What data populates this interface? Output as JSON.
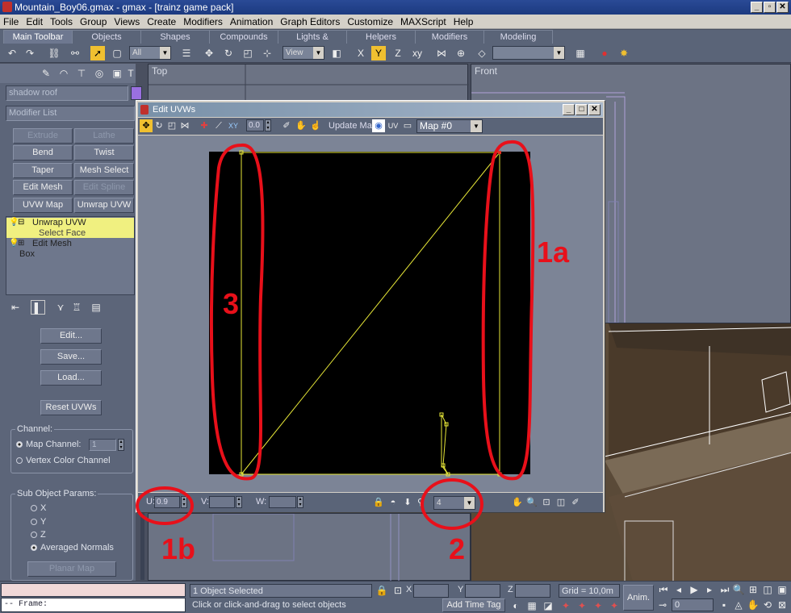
{
  "window": {
    "title": "Mountain_Boy06.gmax - gmax - [trainz game pack]",
    "minimize": "_",
    "restore": "▫",
    "close": "✕"
  },
  "menu": [
    "File",
    "Edit",
    "Tools",
    "Group",
    "Views",
    "Create",
    "Modifiers",
    "Animation",
    "Graph Editors",
    "Customize",
    "MAXScript",
    "Help"
  ],
  "tabs": [
    "Main Toolbar",
    "Objects",
    "Shapes",
    "Compounds",
    "Lights & Cameras",
    "Helpers",
    "Modifiers",
    "Modeling"
  ],
  "toolbar": {
    "selection_filter": "All",
    "coord_system": "View"
  },
  "command_panel": {
    "object_name": "shadow roof",
    "modifier_list": "Modifier List",
    "buttons": [
      "Extrude",
      "Lathe",
      "Bend",
      "Twist",
      "Taper",
      "Mesh Select",
      "Edit Mesh",
      "Edit Spline",
      "UVW Map",
      "Unwrap UVW"
    ],
    "stack": [
      "Unwrap UVW",
      "Select Face",
      "Edit Mesh",
      "Box"
    ],
    "rollout_buttons": [
      "Edit...",
      "Save...",
      "Load..."
    ],
    "reset_button": "Reset UVWs",
    "channel_label": "Channel:",
    "map_channel_label": "Map Channel:",
    "map_channel_value": "1",
    "vertex_color_label": "Vertex Color Channel",
    "sub_object_label": "Sub Object Params:",
    "axes": [
      "X",
      "Y",
      "Z",
      "Averaged Normals"
    ],
    "planar_map": "Planar Map"
  },
  "viewports": {
    "top": "Top",
    "front": "Front"
  },
  "dialog": {
    "title": "Edit UVWs",
    "spinner_value": "0.0",
    "update_map": "Update Map",
    "map_select": "Map #0",
    "u_label": "U:",
    "u_value": "0.9",
    "v_label": "V:",
    "v_value": "",
    "w_label": "W:",
    "w_value": "",
    "filter_value": "4"
  },
  "annotations": [
    "1a",
    "1b",
    "2",
    "3"
  ],
  "status": {
    "prompt": "-- Frame:",
    "selection": "1 Object Selected",
    "hint": "Click or click-and-drag to select objects",
    "x_label": "X",
    "y_label": "Y",
    "z_label": "Z",
    "grid": "Grid = 10,0m",
    "add_time_tag": "Add Time Tag",
    "anim": "Anim.",
    "frame_value": "0"
  },
  "colors": {
    "annotation": "#e8101a",
    "uv_lines": "#e8e838",
    "uv_bg": "#000000"
  }
}
